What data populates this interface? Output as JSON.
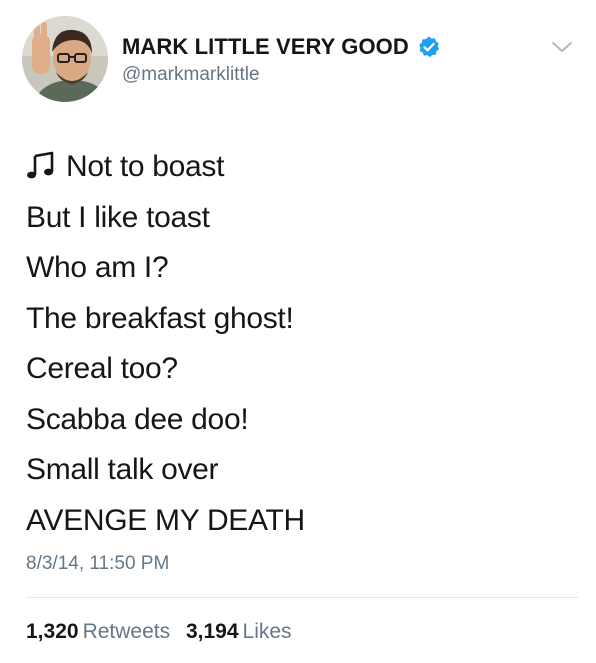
{
  "user": {
    "display_name": "MARK LITTLE VERY GOOD",
    "handle": "@markmarklittle",
    "verified": true
  },
  "tweet": {
    "icon": "music-note-icon",
    "lines": [
      "Not to boast",
      "But I like toast",
      "Who am I?",
      "The breakfast ghost!",
      "Cereal too?",
      "Scabba dee doo!",
      "Small talk over",
      "AVENGE MY DEATH"
    ],
    "timestamp": "8/3/14, 11:50 PM"
  },
  "stats": {
    "retweets_count": "1,320",
    "retweets_label": "Retweets",
    "likes_count": "3,194",
    "likes_label": "Likes"
  },
  "colors": {
    "text": "#14171a",
    "secondary": "#657786",
    "verified": "#1da1f2",
    "divider": "#e1e8ed"
  }
}
